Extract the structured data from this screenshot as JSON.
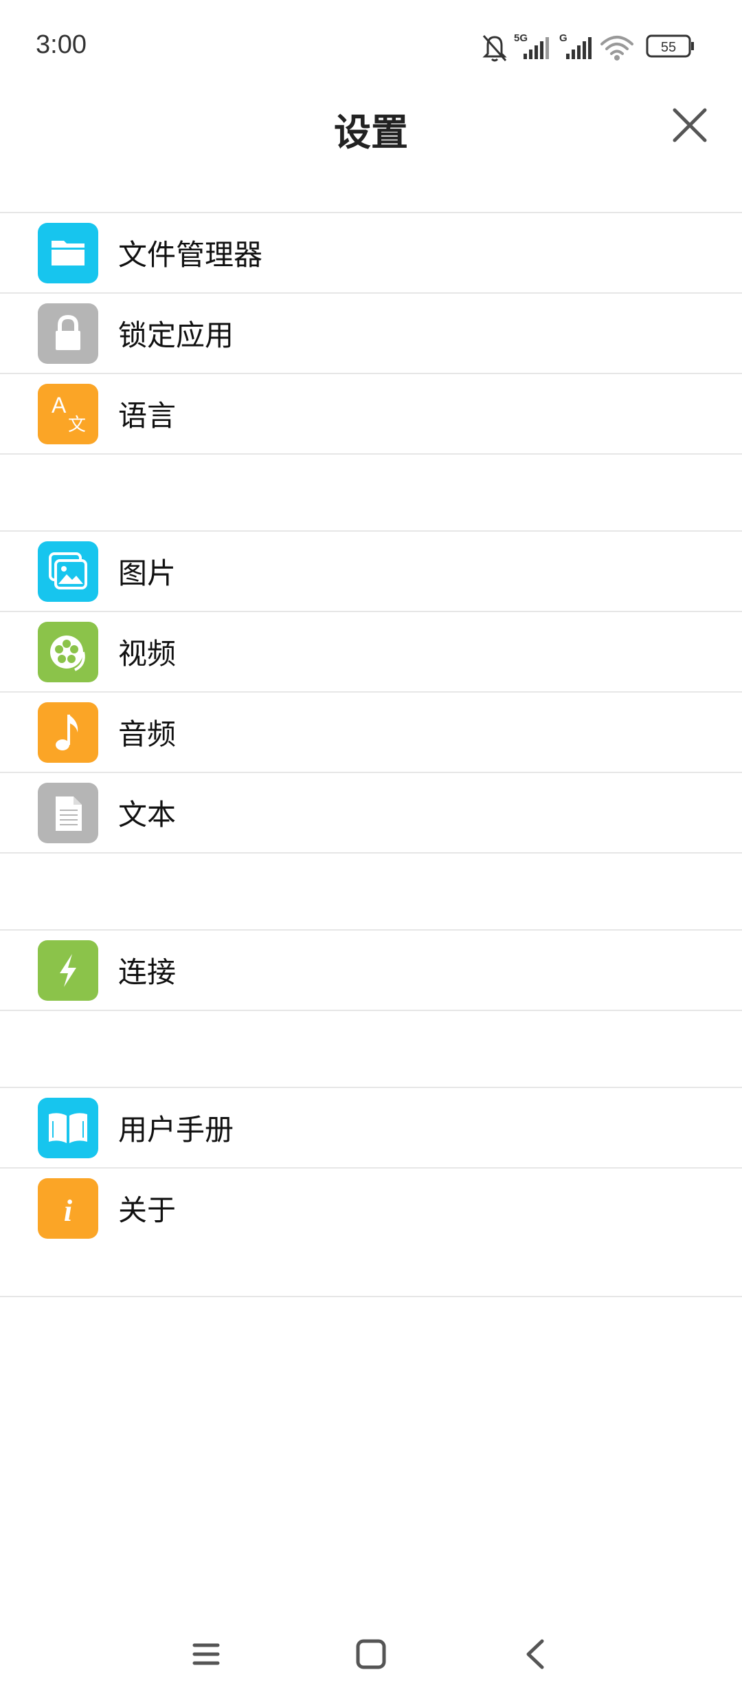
{
  "status_bar": {
    "time": "3:00",
    "network_label_1": "5G",
    "network_label_2": "G",
    "battery": "55",
    "icons": [
      "bell-off-icon",
      "signal-5g-icon",
      "signal-icon",
      "wifi-icon",
      "battery-icon"
    ]
  },
  "header": {
    "title": "设置",
    "close_icon": "close-icon"
  },
  "groups": [
    {
      "items": [
        {
          "label": "文件管理器",
          "icon": "folder-icon",
          "color": "#17c5ee"
        },
        {
          "label": "锁定应用",
          "icon": "lock-icon",
          "color": "#b5b5b5"
        },
        {
          "label": "语言",
          "icon": "language-icon",
          "color": "#fba526"
        }
      ]
    },
    {
      "items": [
        {
          "label": "图片",
          "icon": "photos-icon",
          "color": "#17c5ee"
        },
        {
          "label": "视频",
          "icon": "film-reel-icon",
          "color": "#8bc34a"
        },
        {
          "label": "音频",
          "icon": "music-note-icon",
          "color": "#fba526"
        },
        {
          "label": "文本",
          "icon": "document-icon",
          "color": "#b5b5b5"
        }
      ]
    },
    {
      "items": [
        {
          "label": "连接",
          "icon": "lightning-icon",
          "color": "#8bc34a"
        }
      ]
    },
    {
      "items": [
        {
          "label": "用户手册",
          "icon": "book-icon",
          "color": "#17c5ee"
        },
        {
          "label": "关于",
          "icon": "info-icon",
          "color": "#fba526"
        }
      ]
    }
  ],
  "nav_bar": {
    "icons": [
      "menu-icon",
      "home-icon",
      "back-icon"
    ]
  }
}
